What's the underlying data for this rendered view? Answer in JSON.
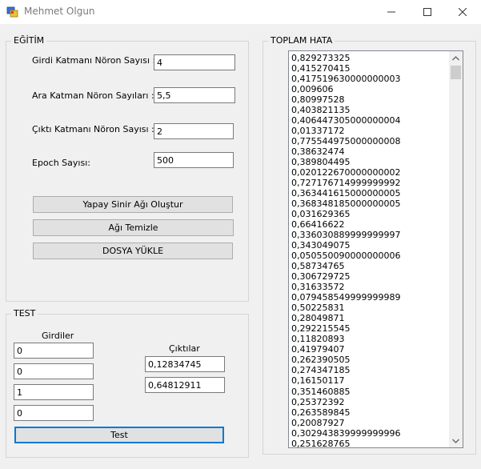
{
  "window": {
    "title": "Mehmet Olgun",
    "icon": "app-icon",
    "controls": [
      "minimize-icon",
      "maximize-icon",
      "close-icon"
    ]
  },
  "training": {
    "title": "EĞİTİM",
    "fields": [
      {
        "label": "Girdi Katmanı Nöron Sayısı :",
        "value": "4"
      },
      {
        "label": "Ara Katman Nöron Sayıları :",
        "value": "5,5"
      },
      {
        "label": "Çıktı Katmanı Nöron Sayısı :",
        "value": "2"
      },
      {
        "label": "Epoch Sayısı:",
        "value": "500"
      }
    ],
    "buttons": {
      "create": "Yapay Sinir Ağı Oluştur",
      "clear": "Ağı Temizle",
      "load": "DOSYA YÜKLE"
    }
  },
  "test": {
    "title": "TEST",
    "inputs_label": "Girdiler",
    "inputs": [
      "0",
      "0",
      "1",
      "0"
    ],
    "outputs_label": "Çıktılar",
    "outputs": [
      "0,12834745",
      "0,64812911"
    ],
    "test_button": "Test"
  },
  "total_error": {
    "title": "TOPLAM HATA",
    "items": [
      "0,829273325",
      "0,415270415",
      "0,417519630000000003",
      "0,009606",
      "0,80997528",
      "0,403821135",
      "0,406447305000000004",
      "0,01337172",
      "0,775544975000000008",
      "0,38632474",
      "0,389804495",
      "0,020122670000000002",
      "0,727176714999999992",
      "0,363441615000000005",
      "0,368348185000000005",
      "0,031629365",
      "0,66416622",
      "0,336030889999999997",
      "0,343049075",
      "0,050550090000000006",
      "0,58734765",
      "0,306729725",
      "0,31633572",
      "0,079458549999999989",
      "0,50225831",
      "0,28049871",
      "0,292215545",
      "0,11820893",
      "0,41979407",
      "0,262390505",
      "0,274347185",
      "0,16150117",
      "0,351460885",
      "0,25372392",
      "0,263589845",
      "0,20087927",
      "0,302943839999999996",
      "0,251628765"
    ],
    "scroll_up_icon": "scroll-up-arrow-icon",
    "scroll_down_icon": "scroll-down-arrow-icon"
  }
}
